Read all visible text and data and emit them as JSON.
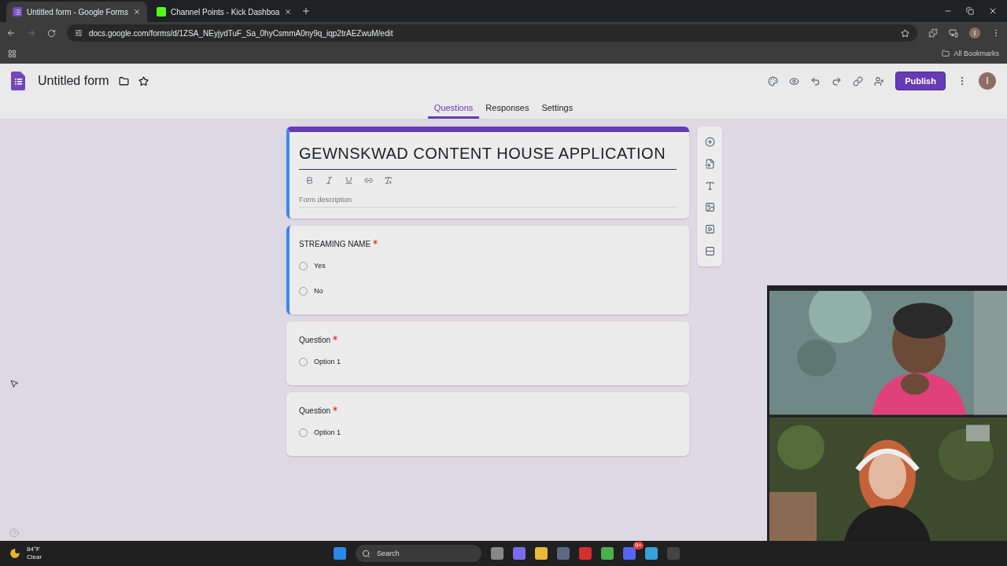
{
  "browser": {
    "tabs": [
      {
        "title": "Untitled form - Google Forms",
        "selected": true,
        "kind": "forms"
      },
      {
        "title": "Channel Points - Kick Dashboa",
        "selected": false,
        "kind": "kick"
      }
    ],
    "url": "docs.google.com/forms/d/1ZSA_NEyjydTuF_Sa_0hyCsmmA0ny9q_iqp2trAEZwuM/edit",
    "profile_letter": "I",
    "bookmarks_label": "All Bookmarks"
  },
  "form_header": {
    "title": "Untitled form",
    "publish": "Publish",
    "avatar_letter": "I",
    "tabs": [
      {
        "label": "Questions",
        "selected": true
      },
      {
        "label": "Responses",
        "selected": false
      },
      {
        "label": "Settings",
        "selected": false
      }
    ]
  },
  "form": {
    "title": "GEWNSKWAD CONTENT HOUSE APPLICATION",
    "description_placeholder": "Form description",
    "questions": [
      {
        "title": "STREAMING NAME",
        "required": true,
        "focused": true,
        "options": [
          {
            "label": "Yes",
            "selected": false
          },
          {
            "label": "No",
            "selected": false
          }
        ]
      },
      {
        "title": "Question",
        "required": true,
        "focused": false,
        "options": [
          {
            "label": "Option 1",
            "selected": false
          }
        ]
      },
      {
        "title": "Question",
        "required": true,
        "focused": false,
        "options": [
          {
            "label": "Option 1",
            "selected": false
          }
        ]
      }
    ]
  },
  "taskbar": {
    "temperature": "84°F",
    "weather": "Clear",
    "search": "Search",
    "chat_badge": "9+"
  }
}
